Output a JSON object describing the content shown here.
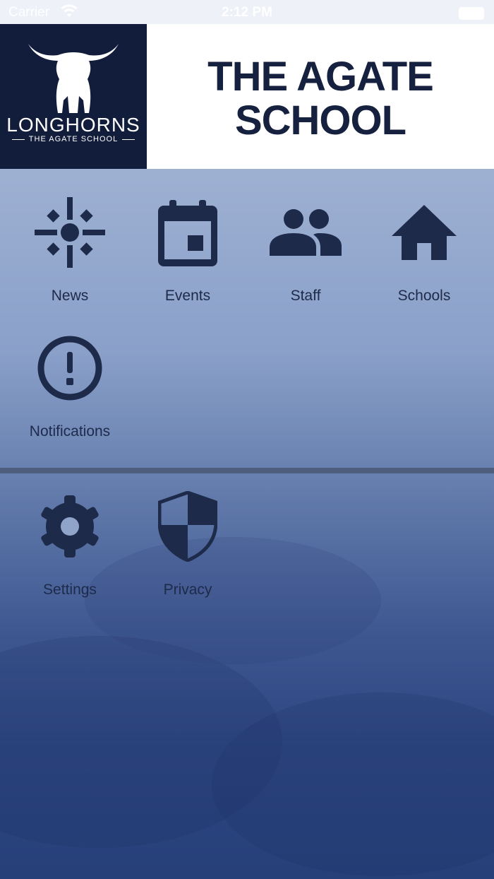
{
  "status_bar": {
    "carrier": "Carrier",
    "time": "2:12 PM"
  },
  "header": {
    "logo_wordmark": "LONGHORNS",
    "logo_subtitle": "THE AGATE SCHOOL",
    "title_line1": "THE AGATE",
    "title_line2": "SCHOOL"
  },
  "menu": {
    "items": [
      {
        "label": "News",
        "icon": "sun-icon"
      },
      {
        "label": "Events",
        "icon": "calendar-icon"
      },
      {
        "label": "Staff",
        "icon": "people-icon"
      },
      {
        "label": "Schools",
        "icon": "home-icon"
      },
      {
        "label": "Notifications",
        "icon": "alert-circle-icon"
      }
    ],
    "secondary_items": [
      {
        "label": "Settings",
        "icon": "gear-icon"
      },
      {
        "label": "Privacy",
        "icon": "shield-icon"
      }
    ]
  },
  "colors": {
    "navy": "#15213f",
    "logo_bg": "#121d3b",
    "divider": "#4e5e7e"
  }
}
